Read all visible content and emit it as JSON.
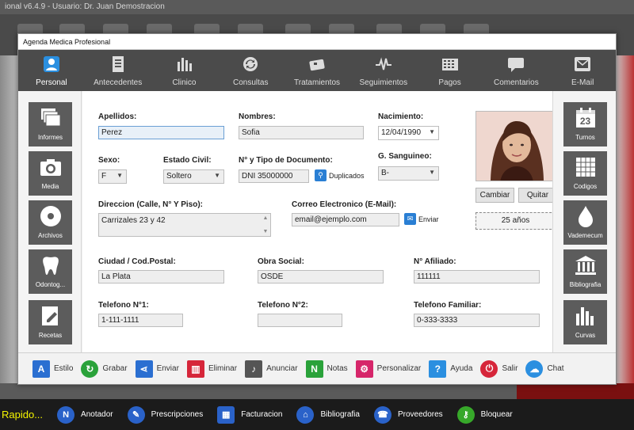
{
  "bg": {
    "title": "ional v6.4.9 - Usuario: Dr. Juan Demostracion"
  },
  "quickbar": {
    "label": "Rapido...",
    "items": [
      {
        "label": "Anotador",
        "icon": "notepad-icon",
        "color": "#2a62c9"
      },
      {
        "label": "Prescripciones",
        "icon": "prescription-icon",
        "color": "#2a62c9"
      },
      {
        "label": "Facturacion",
        "icon": "calculator-icon",
        "color": "#2a62c9"
      },
      {
        "label": "Bibliografia",
        "icon": "library-icon",
        "color": "#2a62c9"
      },
      {
        "label": "Proveedores",
        "icon": "phone-icon",
        "color": "#2a62c9"
      },
      {
        "label": "Bloquear",
        "icon": "key-icon",
        "color": "#37a82a"
      }
    ]
  },
  "window": {
    "title": "Agenda Medica Profesional"
  },
  "tabs": [
    {
      "label": "Personal",
      "icon": "person-icon",
      "active": true
    },
    {
      "label": "Antecedentes",
      "icon": "document-icon"
    },
    {
      "label": "Clinico",
      "icon": "bar-chart-icon"
    },
    {
      "label": "Consultas",
      "icon": "refresh-icon"
    },
    {
      "label": "Tratamientos",
      "icon": "pill-box-icon"
    },
    {
      "label": "Seguimientos",
      "icon": "pulse-icon"
    },
    {
      "label": "Pagos",
      "icon": "calculator-icon"
    },
    {
      "label": "Comentarios",
      "icon": "comment-icon"
    },
    {
      "label": "E-Mail",
      "icon": "mail-icon"
    }
  ],
  "left_sidebar": [
    {
      "label": "Informes",
      "icon": "reports-icon"
    },
    {
      "label": "Media",
      "icon": "camera-icon"
    },
    {
      "label": "Archivos",
      "icon": "disc-icon"
    },
    {
      "label": "Odontog...",
      "icon": "tooth-icon"
    },
    {
      "label": "Recetas",
      "icon": "prescription-pad-icon"
    }
  ],
  "right_sidebar": [
    {
      "label": "Turnos",
      "icon": "calendar-icon",
      "badge": "23"
    },
    {
      "label": "Codigos",
      "icon": "grid-icon"
    },
    {
      "label": "Vademecum",
      "icon": "drop-icon"
    },
    {
      "label": "Bibliografia",
      "icon": "library-icon"
    },
    {
      "label": "Curvas",
      "icon": "bar-chart-icon"
    }
  ],
  "form": {
    "apellidos": {
      "label": "Apellidos:",
      "value": "Perez"
    },
    "nombres": {
      "label": "Nombres:",
      "value": "Sofia"
    },
    "nacimiento": {
      "label": "Nacimiento:",
      "value": "12/04/1990"
    },
    "sexo": {
      "label": "Sexo:",
      "value": "F"
    },
    "estado_civil": {
      "label": "Estado Civil:",
      "value": "Soltero"
    },
    "documento": {
      "label": "N° y Tipo de Documento:",
      "value": "DNI 35000000",
      "duplicados": "Duplicados"
    },
    "sanguineo": {
      "label": "G. Sanguineo:",
      "value": "B-"
    },
    "direccion": {
      "label": "Direccion (Calle,  N° Y Piso):",
      "value": "Carrizales 23 y 42"
    },
    "correo": {
      "label": "Correo Electronico (E-Mail):",
      "value": "email@ejemplo.com",
      "enviar": "Enviar"
    },
    "ciudad": {
      "label": "Ciudad / Cod.Postal:",
      "value": "La Plata"
    },
    "obra_social": {
      "label": "Obra Social:",
      "value": "OSDE"
    },
    "afiliado": {
      "label": "N° Afiliado:",
      "value": "111111"
    },
    "telefono1": {
      "label": "Telefono N°1:",
      "value": "1-111-1111"
    },
    "telefono2": {
      "label": "Telefono N°2:",
      "value": ""
    },
    "telefono_familiar": {
      "label": "Telefono Familiar:",
      "value": "0-333-3333"
    },
    "photo_buttons": {
      "cambiar": "Cambiar",
      "quitar": "Quitar"
    },
    "edad": "25 años"
  },
  "actions": [
    {
      "label": "Estilo",
      "icon": "style-icon",
      "color": "#2b6fd1"
    },
    {
      "label": "Grabar",
      "icon": "save-icon",
      "color": "#2aa23a"
    },
    {
      "label": "Enviar",
      "icon": "share-icon",
      "color": "#2b6fd1"
    },
    {
      "label": "Eliminar",
      "icon": "trash-icon",
      "color": "#d6263a"
    },
    {
      "label": "Anunciar",
      "icon": "microphone-icon",
      "color": "#555555"
    },
    {
      "label": "Notas",
      "icon": "notes-icon",
      "color": "#2aa23a"
    },
    {
      "label": "Personalizar",
      "icon": "gear-icon",
      "color": "#d6266a"
    },
    {
      "label": "Ayuda",
      "icon": "help-icon",
      "color": "#2b8fe0"
    },
    {
      "label": "Salir",
      "icon": "power-icon",
      "color": "#d6263a"
    },
    {
      "label": "Chat",
      "icon": "chat-icon",
      "color": "#2b8fe0"
    }
  ]
}
